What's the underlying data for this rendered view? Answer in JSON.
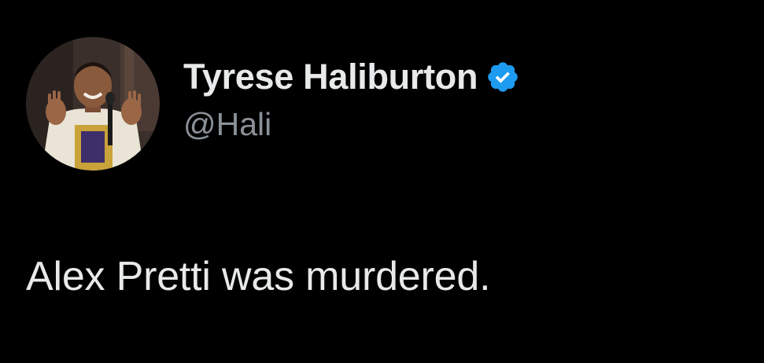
{
  "tweet": {
    "author": {
      "display_name": "Tyrese Haliburton",
      "handle": "@Hali",
      "verified": true,
      "verified_badge_icon": "verified-badge-icon",
      "avatar_icon": "avatar"
    },
    "text": "Alex Pretti was murdered."
  },
  "colors": {
    "background": "#000000",
    "primary_text": "#e7e9ea",
    "secondary_text": "#8b9198",
    "verified_blue": "#1d9bf0"
  }
}
